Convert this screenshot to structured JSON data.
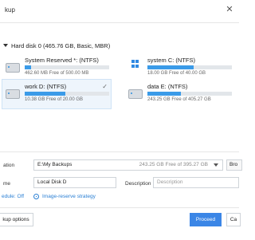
{
  "window": {
    "title": "kup"
  },
  "disk": {
    "header": "Hard disk 0 (465.76 GB, Basic, MBR)"
  },
  "partitions": [
    {
      "name": "System Reserved *: (NTFS)",
      "free": "462.60 MB Free of 500.00 MB",
      "used_fraction": 0.08,
      "selected": false
    },
    {
      "name": "system C: (NTFS)",
      "free": "18.00 GB Free of 40.00 GB",
      "used_fraction": 0.55,
      "selected": false
    },
    {
      "name": "work D: (NTFS)",
      "free": "10.38 GB Free of 20.00 GB",
      "used_fraction": 0.48,
      "selected": true
    },
    {
      "name": "data E: (NTFS)",
      "free": "243.25 GB Free of 405.27 GB",
      "used_fraction": 0.4,
      "selected": false
    }
  ],
  "destination": {
    "label": "ation",
    "value": "E:\\My Backups",
    "free": "243.25 GB Free of 395.27 GB",
    "browse": "Bro"
  },
  "plan": {
    "name_label": "me",
    "name_value": "Local Disk D",
    "description_label": "Description",
    "description_placeholder": "Description"
  },
  "options": {
    "schedule": "edule: Off",
    "image_reserve": "Image-reserve strategy"
  },
  "footer": {
    "backup_options": "kup options",
    "proceed": "Proceed",
    "cancel": "Ca"
  },
  "colors": {
    "accent": "#3b86e6",
    "bar_fill": "#3b9be8",
    "link": "#2a7fd4"
  }
}
